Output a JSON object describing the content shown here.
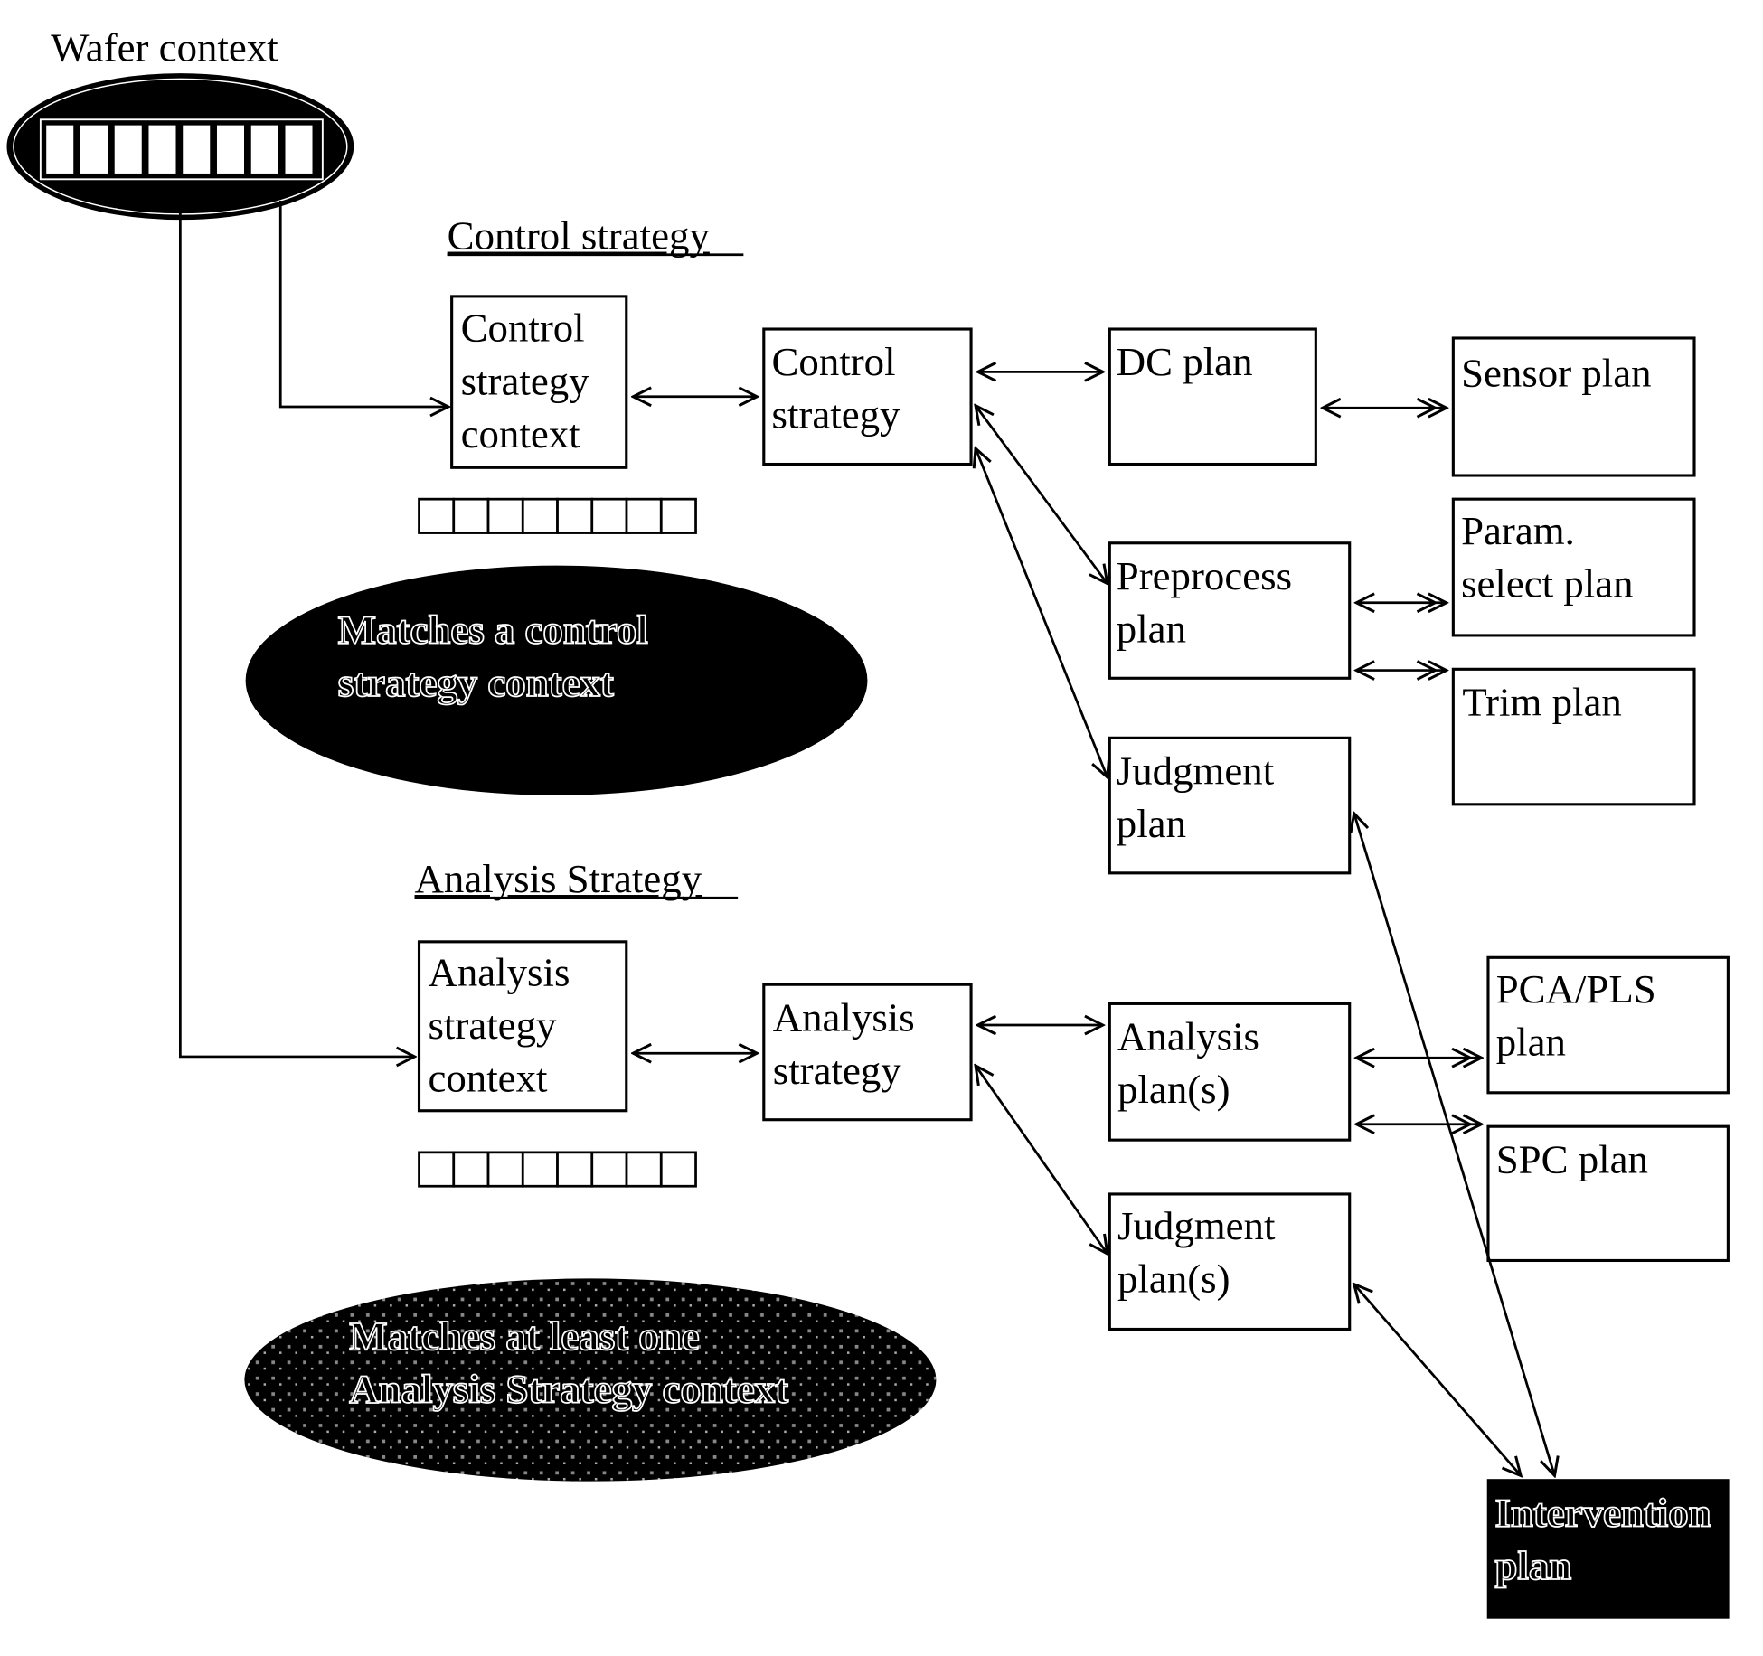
{
  "diagram": {
    "wafer_context": {
      "label": "Wafer context",
      "cells": 8
    },
    "sections": {
      "control": {
        "heading": "Control strategy",
        "match_note": [
          "Matches a control",
          "strategy context"
        ]
      },
      "analysis": {
        "heading": "Analysis Strategy",
        "match_note": [
          "Matches at least one",
          "Analysis Strategy context"
        ]
      }
    },
    "nodes": {
      "control_context": [
        "Control",
        "strategy",
        "context"
      ],
      "control_strategy": [
        "Control",
        "strategy"
      ],
      "dc_plan": [
        "DC plan"
      ],
      "sensor_plan": [
        "Sensor plan"
      ],
      "preprocess_plan": [
        "Preprocess",
        "plan"
      ],
      "param_select_plan": [
        "Param.",
        "select plan"
      ],
      "trim_plan": [
        "Trim plan"
      ],
      "judgment_plan": [
        "Judgment",
        "plan"
      ],
      "analysis_context": [
        "Analysis",
        "strategy",
        "context"
      ],
      "analysis_strategy": [
        "Analysis",
        "strategy"
      ],
      "analysis_plans": [
        "Analysis",
        "plan(s)"
      ],
      "pca_pls_plan": [
        "PCA/PLS",
        "plan"
      ],
      "spc_plan": [
        "SPC plan"
      ],
      "judgment_plans": [
        "Judgment",
        "plan(s)"
      ],
      "intervention_plan": [
        "Intervention",
        "plan"
      ]
    },
    "context_cells": {
      "control": 8,
      "analysis": 8
    },
    "colors": {
      "ink": "#000000",
      "paper": "#ffffff"
    }
  }
}
